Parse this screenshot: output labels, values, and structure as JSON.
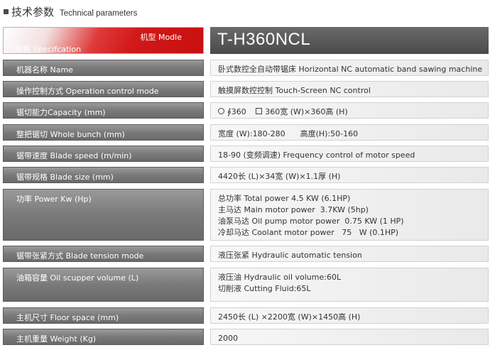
{
  "heading": {
    "zh": "技术参数",
    "en": "Technical parameters"
  },
  "header": {
    "model_label": "机型 Modle",
    "spec_label": "规格 Specifcation",
    "model_value": "T-H360NCL"
  },
  "rows": [
    {
      "label": "机器名称 Name",
      "lines": [
        "卧式数控全自动带锯床 Horizontal NC automatic band sawing machine"
      ]
    },
    {
      "label": "操作控制方式 Operation control mode",
      "lines": [
        "触摸屏数控控制 Touch-Screen NC control"
      ]
    },
    {
      "label": "锯切能力Capacity (mm)",
      "capacity": {
        "round": "∮360",
        "square": "360宽 (W)×360高 (H)"
      }
    },
    {
      "label": "整把锯切 Whole bunch (mm)",
      "lines": [
        "宽度 (W):180-280      高度(H):50-160"
      ]
    },
    {
      "label": "锯带速度 Blade speed (m/min)",
      "lines": [
        "18-90 (变频调速) Frequency control of motor speed"
      ]
    },
    {
      "label": "锯带规格 Blade size (mm)",
      "lines": [
        "4420长 (L)×34宽 (W)×1.1厚 (H)"
      ]
    },
    {
      "label": "功率 Power Kw (Hp)",
      "lines": [
        "总功率 Total power 4.5 KW (6.1HP)",
        "主马达 Main motor power  3.7KW (5hp)",
        "油泵马达 Oil pump motor power  0.75 KW (1 HP)",
        "冷却马达 Coolant motor power   75   W (0.1HP)"
      ]
    },
    {
      "label": "锯带张紧方式 Blade tension mode",
      "lines": [
        "液压张紧 Hydraulic automatic tension"
      ]
    },
    {
      "label": "油箱容量 Oil scupper volume (L)",
      "lines": [
        "液压油 Hydraulic oil volume:60L",
        "切削液 Cutting Fluid:65L"
      ]
    },
    {
      "label": "主机尺寸 Floor space (mm)",
      "lines": [
        "2450长 (L) ×2200宽 (W)×1450高 (H)"
      ]
    },
    {
      "label": "主机重量 Weight (Kg)",
      "lines": [
        "2000"
      ]
    }
  ]
}
